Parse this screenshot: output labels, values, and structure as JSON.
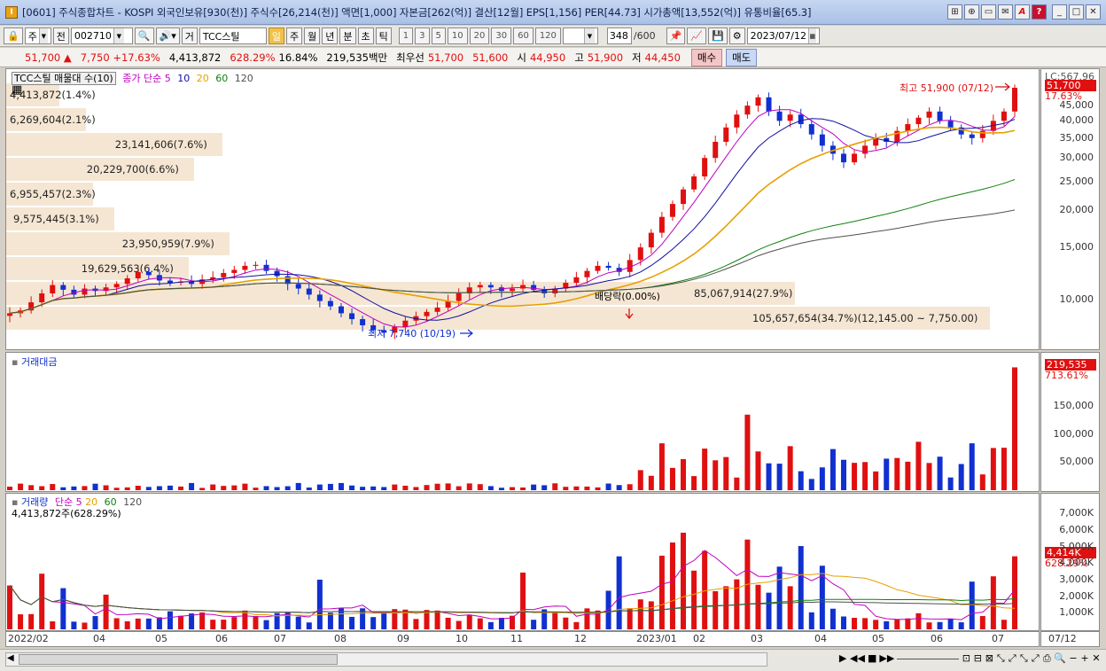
{
  "window": {
    "title": "[0601] 주식종합차트 - KOSPI 외국인보유[930(천)] 주식수[26,214(천)] 액면[1,000] 자본금[262(억)] 결산[12월] EPS[1,156] PER[44.73] 시가총액[13,552(억)] 유통비율[65.3]",
    "buttons": [
      "⊞",
      "⊕",
      "▭",
      "✉",
      "A",
      "?",
      "_",
      "□",
      "✕"
    ]
  },
  "toolbar": {
    "period_select": "주",
    "all_label": "전",
    "code": "002710",
    "type_label": "거",
    "stock_name": "TCC스틸",
    "period_tabs": [
      "일",
      "주",
      "월",
      "년",
      "분",
      "초",
      "틱"
    ],
    "interval_buttons": [
      "1",
      "3",
      "5",
      "10",
      "20",
      "30",
      "60",
      "120"
    ],
    "count": "348",
    "total": "/600",
    "date": "2023/07/12"
  },
  "quote": {
    "price": "51,700 ▲",
    "change": "7,750 +17.63%",
    "volume": "4,413,872",
    "vol_ratio": "628.29%",
    "turnover": "16.84%",
    "amount": "219,535백만",
    "best_label": "최우선",
    "ask": "51,700",
    "bid": "51,600",
    "open_label": "시",
    "open": "44,950",
    "high_label": "고",
    "high": "51,900",
    "low_label": "저",
    "low": "44,450",
    "buy": "매수",
    "sell": "매도"
  },
  "price_panel": {
    "legend_name": "TCC스틸 매물대 수(10)",
    "legend_ma": "종가 단순 5",
    "legend_periods": [
      "10",
      "20",
      "60",
      "120"
    ],
    "legend_colors": [
      "#c000c0",
      "#1010a0",
      "#e8a000",
      "#108010",
      "#505050"
    ],
    "volume_profile": [
      {
        "label": "4,413,872(1.4%)",
        "pct": 1.4
      },
      {
        "label": "6,269,604(2.1%)",
        "pct": 2.1
      },
      {
        "label": "23,141,606(7.6%)",
        "pct": 7.6
      },
      {
        "label": "20,229,700(6.6%)",
        "pct": 6.6
      },
      {
        "label": "6,955,457(2.3%)",
        "pct": 2.3
      },
      {
        "label": "9,575,445(3.1%)",
        "pct": 3.1
      },
      {
        "label": "23,950,959(7.9%)",
        "pct": 7.9
      },
      {
        "label": "19,629,563(6.4%)",
        "pct": 6.4
      },
      {
        "label": "85,067,914(27.9%)",
        "pct": 27.9
      },
      {
        "label": "105,657,654(34.7%)(12,145.00 ~ 7,750.00)",
        "pct": 34.7
      }
    ],
    "low_annotation": "최저 7,740 (10/19)",
    "high_annotation": "최고 51,900 (07/12)",
    "dividend_annotation": "배당락(0.00%)",
    "yaxis_top": "LC:567.96",
    "price_badge": "51,700",
    "price_pct": "17.63%",
    "yticks": [
      "45,000",
      "40,000",
      "35,000",
      "30,000",
      "25,000",
      "20,000",
      "15,000",
      "10,000"
    ]
  },
  "amount_panel": {
    "title": "거래대금",
    "badge": "219,535",
    "pct": "713.61%",
    "yticks": [
      "150,000",
      "100,000",
      "50,000"
    ]
  },
  "volume_panel": {
    "title": "거래량",
    "legend_ma": "단순 5",
    "legend_periods": [
      "20",
      "60",
      "120"
    ],
    "subtitle": "4,413,872주(628.29%)",
    "badge": "4,414K",
    "pct": "628.29%",
    "yticks": [
      "7,000K",
      "6,000K",
      "5,000K",
      "4,000K",
      "3,000K",
      "2,000K",
      "1,000K"
    ]
  },
  "xaxis": {
    "labels": [
      "2022/02",
      "04",
      "05",
      "06",
      "07",
      "08",
      "09",
      "10",
      "11",
      "12",
      "2023/01",
      "02",
      "03",
      "04",
      "05",
      "06",
      "07"
    ],
    "right_label": "07/12"
  },
  "chart_data": {
    "type": "candlestick",
    "title": "TCC스틸 (002710) 일봉",
    "ylim": [
      7000,
      55000
    ],
    "closes": [
      9000,
      9200,
      9800,
      10500,
      11200,
      10800,
      10400,
      10900,
      10700,
      11000,
      11300,
      11800,
      12400,
      12100,
      11600,
      11400,
      11500,
      11300,
      11700,
      11900,
      12300,
      12600,
      13000,
      13100,
      12500,
      12000,
      11300,
      10900,
      10400,
      9900,
      9500,
      9000,
      8600,
      8200,
      7900,
      7740,
      8100,
      8500,
      8800,
      9100,
      9400,
      9900,
      10500,
      11000,
      11200,
      11000,
      10700,
      10900,
      11200,
      10800,
      10500,
      10900,
      11400,
      11900,
      12500,
      13000,
      12800,
      12400,
      13600,
      15000,
      16800,
      19000,
      21000,
      23500,
      26000,
      30000,
      34000,
      38000,
      42000,
      45000,
      48000,
      43000,
      40000,
      42000,
      39000,
      36000,
      33000,
      31000,
      29000,
      31000,
      33000,
      35000,
      34000,
      37000,
      39000,
      41000,
      43000,
      40000,
      38000,
      36000,
      35000,
      37000,
      40000,
      43000,
      51700
    ],
    "amount_peaks": [
      219535
    ],
    "volume_last": 4413872
  }
}
